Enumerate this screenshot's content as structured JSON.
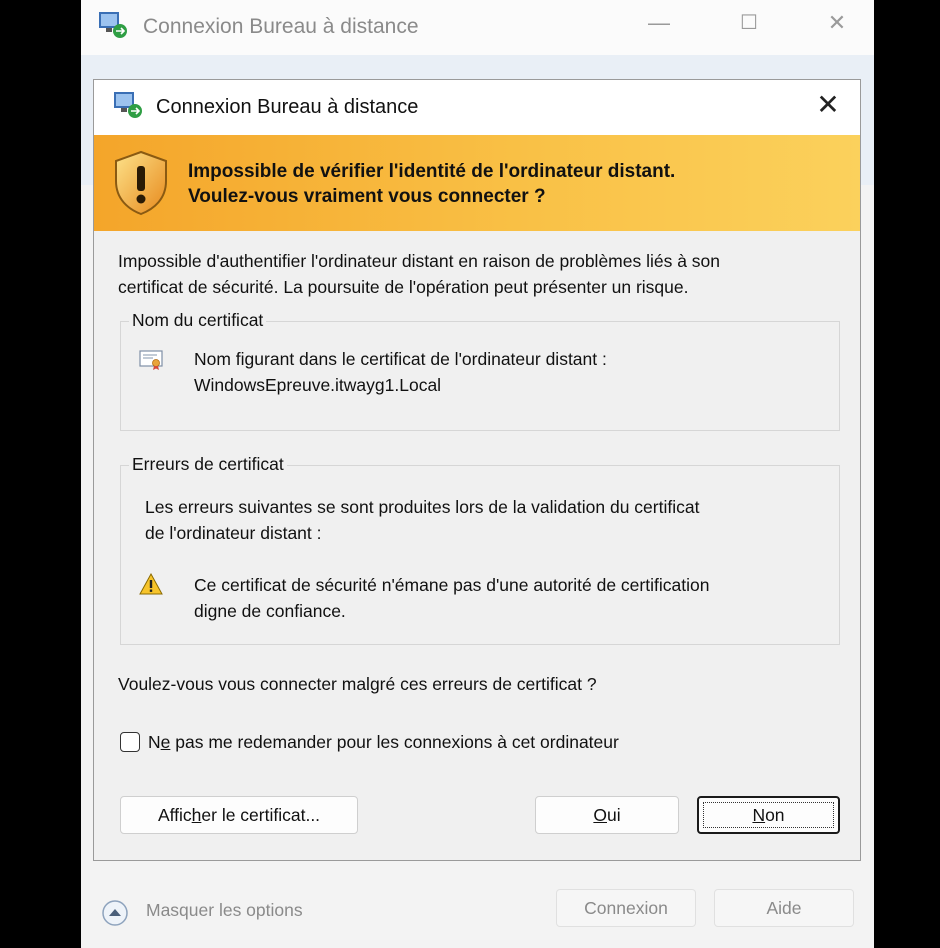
{
  "background_window": {
    "title": "Connexion Bureau à distance",
    "controls": {
      "minimize": "—",
      "maximize": "☐",
      "close": "✕"
    },
    "footer": {
      "toggle_label": "Masquer les options",
      "connect_label": "Connexion",
      "help_label": "Aide"
    }
  },
  "dialog": {
    "title": "Connexion Bureau à distance",
    "close_glyph": "✕",
    "banner": {
      "line1": "Impossible de vérifier l'identité de l'ordinateur distant.",
      "line2": "Voulez-vous vraiment vous connecter ?"
    },
    "description": {
      "line1": "Impossible d'authentifier l'ordinateur distant en raison de problèmes liés à son",
      "line2": "certificat de sécurité. La poursuite de l'opération peut présenter un risque."
    },
    "certificate_name_group": {
      "label": "Nom du certificat",
      "line1": "Nom figurant dans le certificat de l'ordinateur distant :",
      "line2": "WindowsEpreuve.itwayg1.Local"
    },
    "certificate_errors_group": {
      "label": "Erreurs de certificat",
      "intro_line1": "Les erreurs suivantes se sont produites lors de la validation du certificat",
      "intro_line2": "de l'ordinateur distant :",
      "error_line1": "Ce certificat de sécurité n'émane pas d'une autorité de certification",
      "error_line2": "digne de confiance."
    },
    "question": "Voulez-vous vous connecter malgré ces erreurs de certificat ?",
    "checkbox": {
      "label_first": "N",
      "label_underlined": "e",
      "label_rest": " pas me redemander pour les connexions à cet ordinateur",
      "checked": false
    },
    "buttons": {
      "view_cert": {
        "before": "Affic",
        "underlined": "h",
        "after": "er le certificat..."
      },
      "yes": {
        "underlined": "O",
        "after": "ui"
      },
      "no": {
        "underlined": "N",
        "after": "on"
      }
    }
  },
  "colors": {
    "banner_start": "#f4a52a",
    "banner_end": "#fbd15c",
    "dialog_bg": "#f0f0f0"
  }
}
